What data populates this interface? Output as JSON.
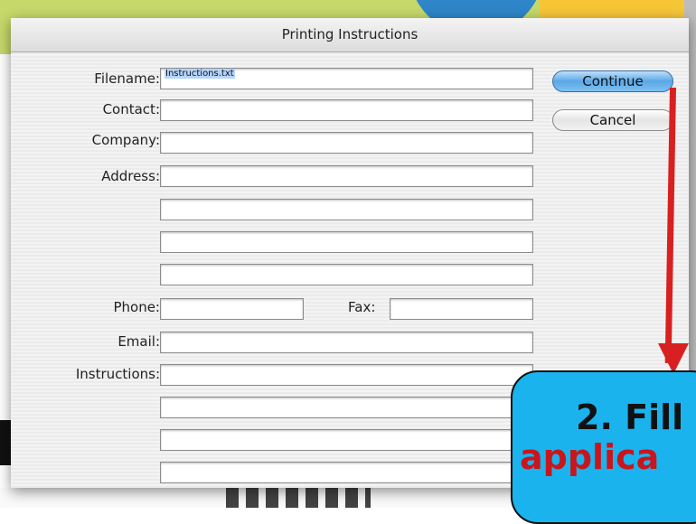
{
  "dialog": {
    "title": "Printing Instructions",
    "labels": {
      "filename": "Filename:",
      "contact": "Contact:",
      "company": "Company:",
      "address": "Address:",
      "phone": "Phone:",
      "fax": "Fax:",
      "email": "Email:",
      "instructions": "Instructions:"
    },
    "fields": {
      "filename": "Instructions.txt",
      "contact": "",
      "company": "",
      "address_1": "",
      "address_2": "",
      "address_3": "",
      "address_4": "",
      "phone": "",
      "fax": "",
      "email": "",
      "instructions_1": "",
      "instructions_2": "",
      "instructions_3": "",
      "instructions_4": ""
    },
    "buttons": {
      "continue": "Continue",
      "cancel": "Cancel"
    }
  },
  "annotation": {
    "line1": "2. Fill",
    "line2": "applica",
    "colors": {
      "callout_bg": "#1ab3ee",
      "arrow": "#d82020",
      "text_red": "#c8161c"
    }
  }
}
